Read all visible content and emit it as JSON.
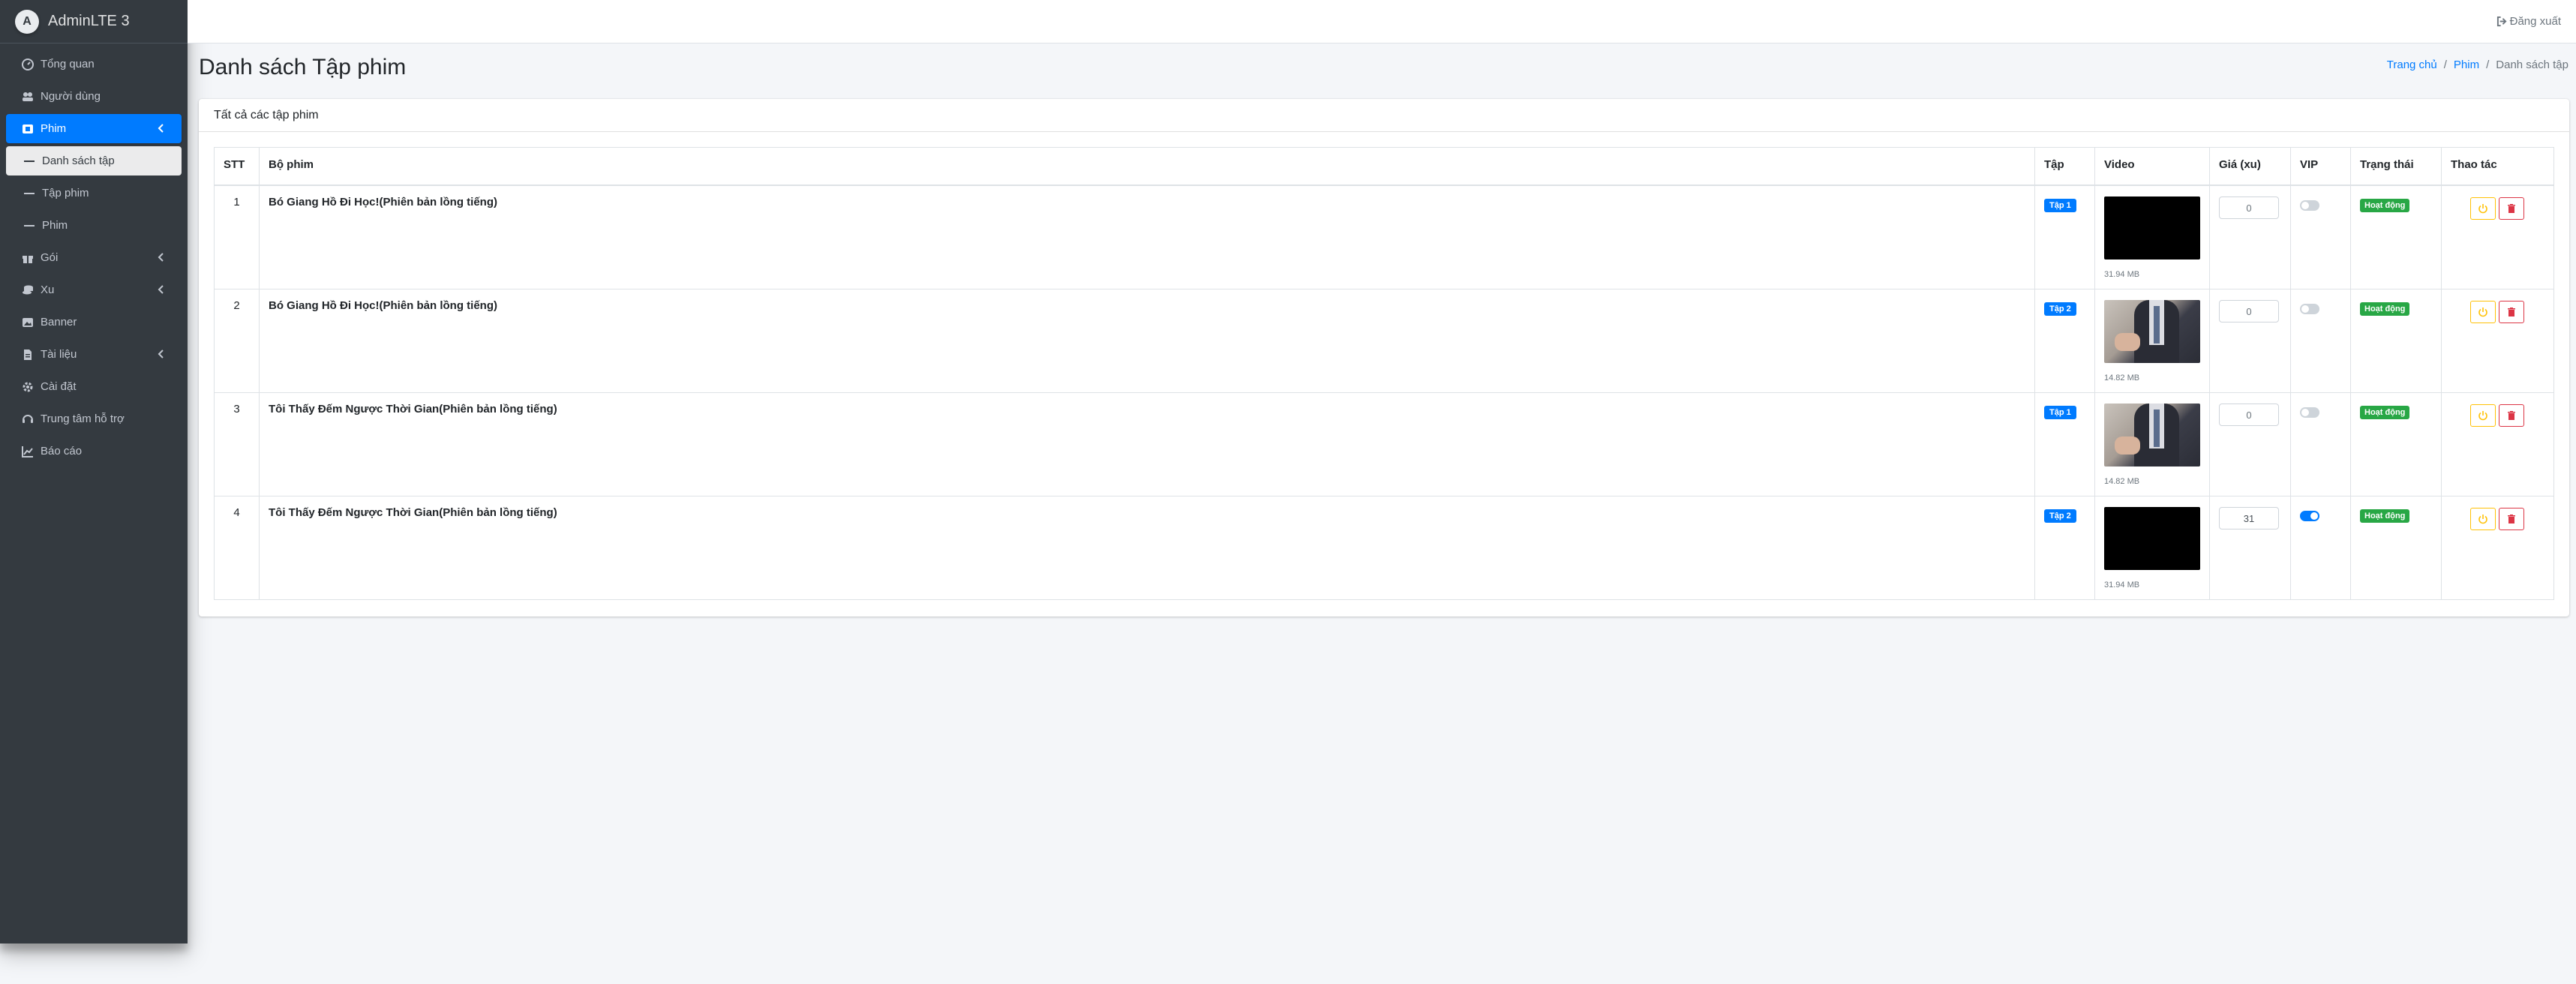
{
  "brand": {
    "title": "AdminLTE 3"
  },
  "sidebar": {
    "items": [
      {
        "label": "Tổng quan",
        "icon": "dashboard-icon"
      },
      {
        "label": "Người dùng",
        "icon": "users-icon"
      },
      {
        "label": "Phim",
        "icon": "film-icon",
        "active": true
      },
      {
        "label": "Danh sách tập",
        "sub": true,
        "selected": true
      },
      {
        "label": "Tập phim",
        "sub": true
      },
      {
        "label": "Phim",
        "sub": true
      },
      {
        "label": "Gói",
        "icon": "gift-icon"
      },
      {
        "label": "Xu",
        "icon": "coins-icon"
      },
      {
        "label": "Banner",
        "icon": "image-icon"
      },
      {
        "label": "Tài liệu",
        "icon": "file-icon"
      },
      {
        "label": "Cài đặt",
        "icon": "gear-icon"
      },
      {
        "label": "Trung tâm hỗ trợ",
        "icon": "headset-icon"
      },
      {
        "label": "Báo cáo",
        "icon": "chart-icon"
      }
    ]
  },
  "topbar": {
    "logout_label": "Đăng xuất"
  },
  "header": {
    "title": "Danh sách Tập phim",
    "breadcrumb": [
      "Trang chủ",
      "Phim",
      "Danh sách tập"
    ]
  },
  "card": {
    "title": "Tất cả các tập phim",
    "columns": [
      "STT",
      "Bộ phim",
      "Tập",
      "Video",
      "Giá (xu)",
      "VIP",
      "Trạng thái",
      "Thao tác"
    ],
    "rows": [
      {
        "stt": "1",
        "series": "Bó Giang Hồ Đi Học!(Phiên bản lồng tiếng)",
        "episode": "Tập 1",
        "video_size": "31.94 MB",
        "price": "0",
        "vip": false,
        "status": "Hoạt động"
      },
      {
        "stt": "2",
        "series": "Bó Giang Hồ Đi Học!(Phiên bản lồng tiếng)",
        "episode": "Tập 2",
        "video_size": "14.82 MB",
        "price": "0",
        "vip": false,
        "status": "Hoạt động"
      },
      {
        "stt": "3",
        "series": "Tôi Thấy Đếm Ngược Thời Gian(Phiên bản lồng tiếng)",
        "episode": "Tập 1",
        "video_size": "14.82 MB",
        "price": "0",
        "vip": false,
        "status": "Hoạt động"
      },
      {
        "stt": "4",
        "series": "Tôi Thấy Đếm Ngược Thời Gian(Phiên bản lồng tiếng)",
        "episode": "Tập 2",
        "video_size": "31.94 MB",
        "price": "31",
        "vip": true,
        "status": "Hoạt động"
      }
    ]
  },
  "colors": {
    "primary": "#007bff",
    "success": "#28a745",
    "warning": "#ffc107",
    "danger": "#dc3545",
    "sidebar": "#343a40"
  }
}
